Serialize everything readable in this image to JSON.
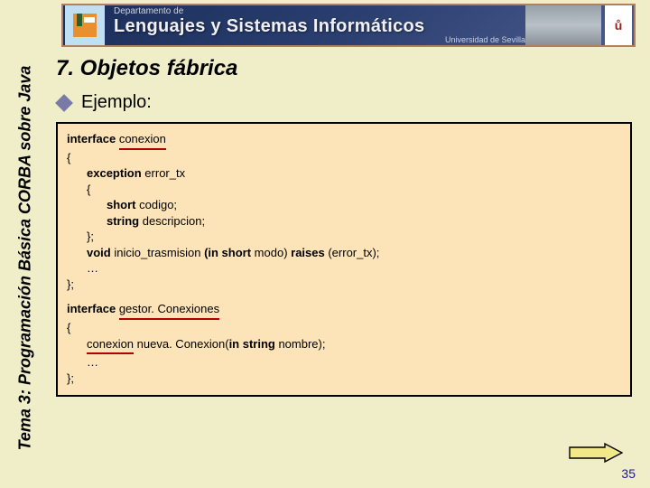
{
  "banner": {
    "dept": "Departamento de",
    "main": "Lenguajes y Sistemas Informáticos",
    "uni": "Universidad de Sevilla",
    "shield_text": "ů"
  },
  "side": {
    "label": "Tema 3: Programación Básica CORBA sobre Java"
  },
  "heading": "7. Objetos fábrica",
  "bullet": "Ejemplo:",
  "code": {
    "l1_kw": "interface",
    "l1_name": "conexion",
    "l2": "{",
    "l3_kw": "exception",
    "l3_rest": " error_tx",
    "l4": "{",
    "l5_kw": "short",
    "l5_rest": " codigo;",
    "l6_kw": "string",
    "l6_rest": " descripcion;",
    "l7": "};",
    "l8_a": "void",
    "l8_b": " inicio_trasmision ",
    "l8_c": "(in short",
    "l8_d": " modo) ",
    "l8_e": "raises",
    "l8_f": " (error_tx);",
    "l9": "…",
    "l10": "};",
    "l11_kw": "interface",
    "l11_name": "gestor. Conexiones",
    "l12": "{",
    "l13_a": "conexion",
    "l13_b": " nueva. Conexion(",
    "l13_c": "in string",
    "l13_d": " nombre);",
    "l14": "…",
    "l15": "};"
  },
  "page_number": "35"
}
